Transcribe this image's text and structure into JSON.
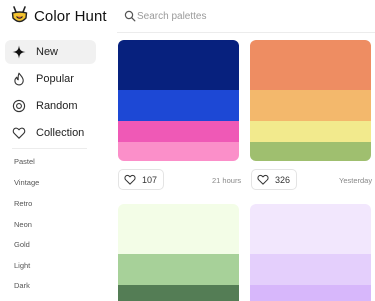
{
  "header": {
    "app_name": "Color Hunt",
    "search_placeholder": "Search palettes"
  },
  "sidebar": {
    "items": [
      {
        "label": "New",
        "icon": "sparkle-icon",
        "active": true
      },
      {
        "label": "Popular",
        "icon": "flame-icon",
        "active": false
      },
      {
        "label": "Random",
        "icon": "random-icon",
        "active": false
      },
      {
        "label": "Collection",
        "icon": "heart-icon",
        "active": false
      }
    ],
    "tags": [
      "Pastel",
      "Vintage",
      "Retro",
      "Neon",
      "Gold",
      "Light",
      "Dark"
    ]
  },
  "palettes": [
    {
      "colors": [
        "#07217e",
        "#1d48d5",
        "#ef59b6",
        "#fb8fc9"
      ],
      "likes": "107",
      "time": "21 hours"
    },
    {
      "colors": [
        "#ee8d62",
        "#f3b86c",
        "#f2ea8d",
        "#9fbf6f"
      ],
      "likes": "326",
      "time": "Yesterday"
    },
    {
      "colors": [
        "#f3fde7",
        "#a7d199",
        "#547d55"
      ],
      "likes": "",
      "time": ""
    },
    {
      "colors": [
        "#f2e7fd",
        "#e4cffc",
        "#d7b7fb"
      ],
      "likes": "",
      "time": ""
    }
  ]
}
